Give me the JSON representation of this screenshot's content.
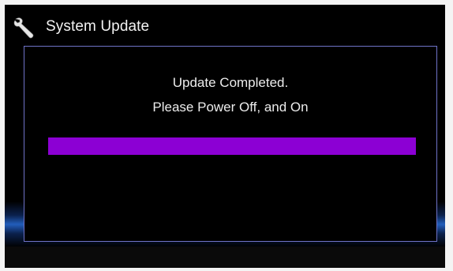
{
  "header": {
    "title": "System Update",
    "icon": "wrench-icon"
  },
  "dialog": {
    "message_line_1": "Update Completed.",
    "message_line_2": "Please Power Off, and On",
    "progress": {
      "percent": 100,
      "color": "#8c00d4"
    }
  },
  "colors": {
    "background": "#000000",
    "dialog_border": "#6f73c8",
    "glow": "#286edc"
  }
}
